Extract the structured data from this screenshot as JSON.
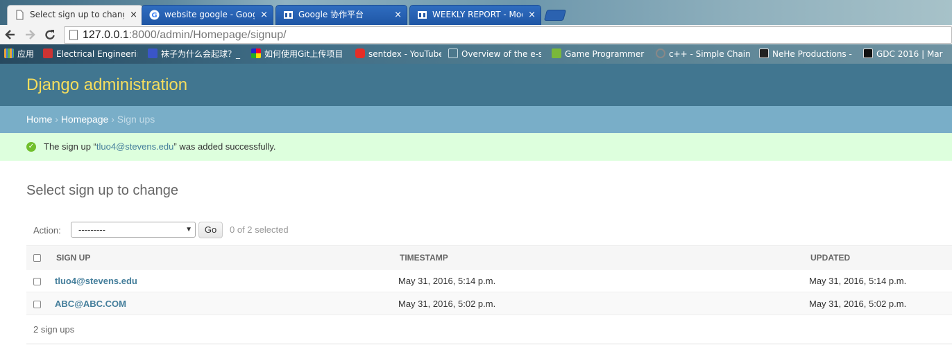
{
  "browser": {
    "tabs": [
      {
        "title": "Select sign up to change |",
        "favicon": "page-icon",
        "active": true
      },
      {
        "title": "website google - Google 搜",
        "favicon": "google-icon",
        "active": false
      },
      {
        "title": "Google 协作平台",
        "favicon": "board-icon",
        "active": false
      },
      {
        "title": "WEEKLY REPORT - Moocyc",
        "favicon": "board-icon",
        "active": false
      }
    ],
    "tab_close": "×",
    "url_host": "127.0.0.1",
    "url_rest": ":8000/admin/Homepage/signup/",
    "bookmarks": [
      {
        "label": "应用",
        "icon": "apps-icon",
        "color": "#e8a33a"
      },
      {
        "label": "Electrical Engineering",
        "icon": "mit-ocw-icon",
        "color": "#c33"
      },
      {
        "label": "袜子为什么会起球？_",
        "icon": "baidu-icon",
        "color": "#3a55c8"
      },
      {
        "label": "如何使用Git上传项目",
        "icon": "colorful-icon",
        "color": "#e0a020"
      },
      {
        "label": "sentdex - YouTube",
        "icon": "youtube-icon",
        "color": "#e52d27"
      },
      {
        "label": "Overview of the e-sign",
        "icon": "page-icon",
        "color": "#6f93a2"
      },
      {
        "label": "Game Programmer Int",
        "icon": "j-icon",
        "color": "#7ab83a"
      },
      {
        "label": "c++ - Simple Chained",
        "icon": "stackoverflow-icon",
        "color": "#888"
      },
      {
        "label": "NeHe Productions - E",
        "icon": "nehe-icon",
        "color": "#222"
      },
      {
        "label": "GDC 2016 | Mar",
        "icon": "gdc-icon",
        "color": "#111"
      }
    ]
  },
  "admin": {
    "site_name": "Django administration",
    "breadcrumbs": {
      "home": "Home",
      "app": "Homepage",
      "current": "Sign ups",
      "separator": "›"
    },
    "message": {
      "prefix": "The sign up “",
      "link": "tluo4@stevens.edu",
      "suffix": "” was added successfully."
    },
    "page_title": "Select sign up to change",
    "actions": {
      "label": "Action:",
      "selected": "---------",
      "go": "Go",
      "counter": "0 of 2 selected"
    },
    "table": {
      "headers": [
        "SIGN UP",
        "TIMESTAMP",
        "UPDATED"
      ],
      "rows": [
        {
          "sign_up": "tluo4@stevens.edu",
          "timestamp": "May 31, 2016, 5:14 p.m.",
          "updated": "May 31, 2016, 5:14 p.m."
        },
        {
          "sign_up": "ABC@ABC.COM",
          "timestamp": "May 31, 2016, 5:02 p.m.",
          "updated": "May 31, 2016, 5:02 p.m."
        }
      ]
    },
    "paginator": "2 sign ups"
  },
  "colors": {
    "header": "#417690",
    "site_name": "#f5dd5d",
    "breadcrumbs": "#79aec8",
    "success": "#dfd",
    "link": "#447e9b"
  }
}
